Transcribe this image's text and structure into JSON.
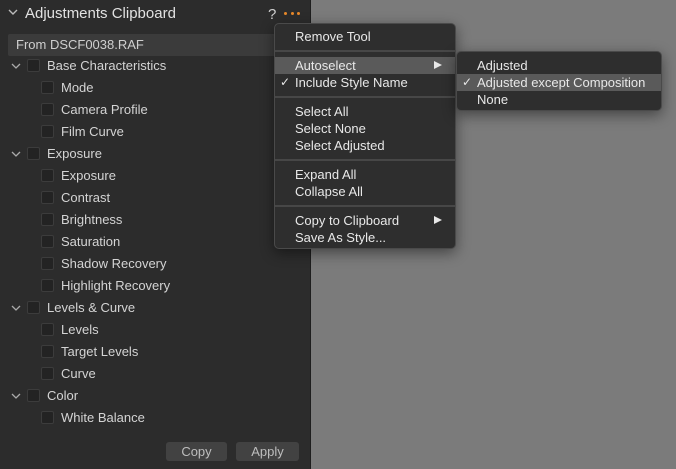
{
  "panel": {
    "title": "Adjustments Clipboard",
    "help": "?",
    "source": "From DSCF0038.RAF",
    "copy_label": "Copy",
    "apply_label": "Apply",
    "groups": [
      {
        "label": "Base Characteristics",
        "items": [
          "Mode",
          "Camera Profile",
          "Film Curve"
        ]
      },
      {
        "label": "Exposure",
        "items": [
          "Exposure",
          "Contrast",
          "Brightness",
          "Saturation",
          "Shadow Recovery",
          "Highlight Recovery"
        ]
      },
      {
        "label": "Levels & Curve",
        "items": [
          "Levels",
          "Target Levels",
          "Curve"
        ]
      },
      {
        "label": "Color",
        "items": [
          "White Balance"
        ]
      }
    ]
  },
  "menu": {
    "remove_tool": "Remove Tool",
    "autoselect": "Autoselect",
    "include_style_name": "Include Style Name",
    "select_all": "Select All",
    "select_none": "Select None",
    "select_adjusted": "Select Adjusted",
    "expand_all": "Expand All",
    "collapse_all": "Collapse All",
    "copy_to_clipboard": "Copy to Clipboard",
    "save_as_style": "Save As Style..."
  },
  "submenu": {
    "adjusted": "Adjusted",
    "adjusted_except_composition": "Adjusted except Composition",
    "none": "None"
  },
  "colors": {
    "accent": "#e8892a",
    "highlight": "#5a5a5a",
    "background": "#7b7b7b"
  }
}
